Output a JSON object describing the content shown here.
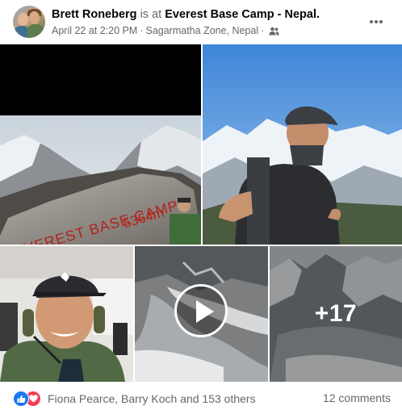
{
  "post": {
    "author": "Brett Roneberg",
    "is_at_text": "is at",
    "place": "Everest Base Camp - Nepal.",
    "timestamp": "April 22 at 2:20 PM",
    "location": "Sagarmatha Zone, Nepal",
    "separator": "·",
    "audience_icon": "friends-icon",
    "more_icon": "more-horizontal-icon"
  },
  "media": {
    "photo_1_sign_line1": "EVEREST BASE CAMP",
    "photo_1_sign_line2": "5364m",
    "play_icon": "play-icon",
    "more_count": "+17"
  },
  "engagement": {
    "reaction_icons": [
      "like-icon",
      "love-icon"
    ],
    "reactors": "Fiona Pearce, Barry Koch and 153 others",
    "comments": "12 comments"
  },
  "colors": {
    "like_blue": "#1877f2",
    "love_red": "#f33e58",
    "secondary_text": "#65676b"
  }
}
